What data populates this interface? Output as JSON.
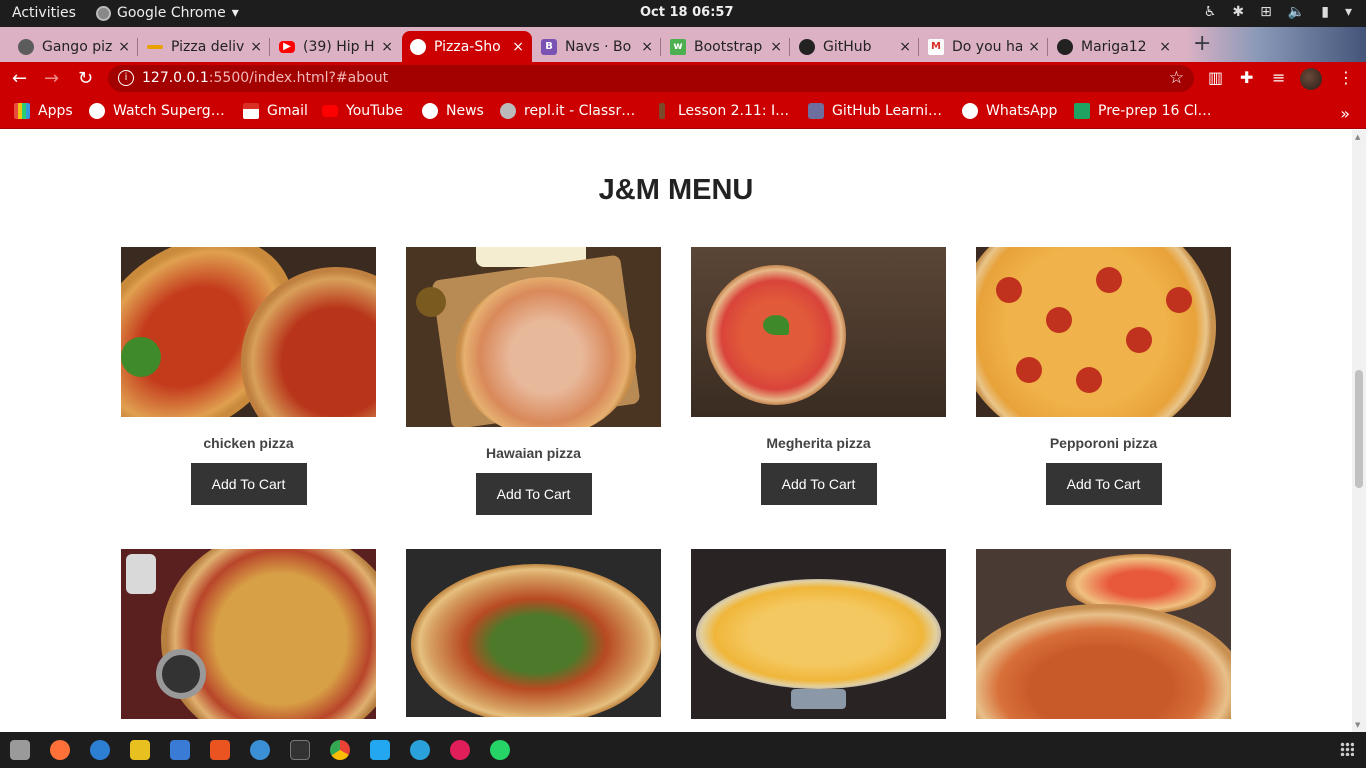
{
  "topbar": {
    "activities": "Activities",
    "app_name": "Google Chrome",
    "app_caret": "▾",
    "clock": "Oct 18  06:57"
  },
  "tabs": [
    {
      "title": "Gango piz",
      "favicon": "globe-icon",
      "color": "#5c5c5c"
    },
    {
      "title": "Pizza deliv",
      "favicon": "pizza-delivery-icon",
      "color": "#e8a100"
    },
    {
      "title": "(39) Hip H",
      "favicon": "youtube-icon",
      "color": "#ff0000"
    },
    {
      "title": "Pizza-Sho",
      "favicon": "globe-icon",
      "color": "#ffffff",
      "active": true
    },
    {
      "title": "Navs · Bo",
      "favicon": "bootstrap-icon",
      "color": "#7952b3"
    },
    {
      "title": "Bootstrap",
      "favicon": "w3schools-icon",
      "color": "#4caf50"
    },
    {
      "title": "GitHub",
      "favicon": "github-icon",
      "color": "#222222"
    },
    {
      "title": "Do you ha",
      "favicon": "gmail-icon",
      "color": "#d93025"
    },
    {
      "title": "Mariga12",
      "favicon": "github-icon",
      "color": "#222222"
    }
  ],
  "tab_close": "×",
  "new_tab": "+",
  "omnibox": {
    "url_host": "127.0.0.1",
    "url_path": ":5500/index.html?#about"
  },
  "bookmarks": [
    {
      "label": "Apps",
      "icon": "apps-grid-icon"
    },
    {
      "label": "Watch Superg…",
      "icon": "globe-icon"
    },
    {
      "label": "Gmail",
      "icon": "gmail-icon"
    },
    {
      "label": "YouTube",
      "icon": "youtube-icon"
    },
    {
      "label": "News",
      "icon": "globe-icon"
    },
    {
      "label": "repl.it - Classr…",
      "icon": "replit-icon"
    },
    {
      "label": "Lesson 2.11: I…",
      "icon": "tree-icon"
    },
    {
      "label": "GitHub Learni…",
      "icon": "github-learning-icon"
    },
    {
      "label": "WhatsApp",
      "icon": "globe-icon"
    },
    {
      "label": "Pre-prep 16 Cl…",
      "icon": "sheets-icon"
    }
  ],
  "bookmarks_more": "»",
  "page": {
    "title": "J&M MENU",
    "cart_label": "Add To Cart",
    "items": [
      {
        "name": "chicken pizza"
      },
      {
        "name": "Hawaian pizza"
      },
      {
        "name": "Megherita pizza"
      },
      {
        "name": "Pepporoni pizza"
      },
      {
        "name": ""
      },
      {
        "name": ""
      },
      {
        "name": ""
      },
      {
        "name": ""
      }
    ]
  },
  "colors": {
    "theme_red": "#cc0000",
    "tab_strip": "#dcb1c4",
    "button_dark": "#343434"
  }
}
